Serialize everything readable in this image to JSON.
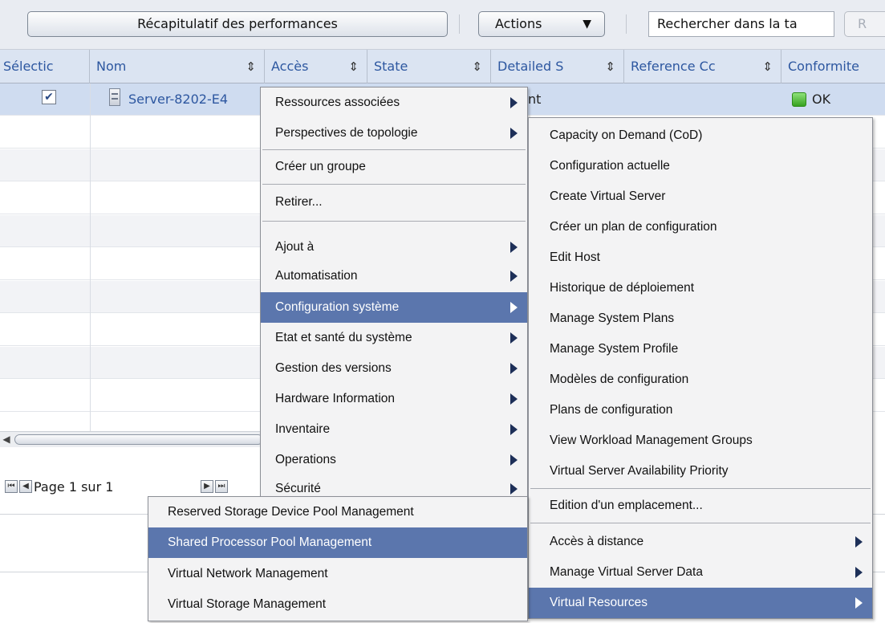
{
  "toolbar": {
    "performance_summary": "Récapitulatif des performances",
    "actions": "Actions",
    "search_value": "Rechercher dans la ta",
    "search_button": "R"
  },
  "table": {
    "columns": [
      "Sélectic",
      "Nom",
      "Accès",
      "State",
      "Detailed S",
      "Reference Cc",
      "Conformite"
    ],
    "row": {
      "checked": true,
      "name": "Server-8202-E4",
      "detailed_state": "nt",
      "compliance": "OK"
    }
  },
  "pagination": {
    "text": "Page 1 sur 1"
  },
  "icons": {
    "sort": "sort-arrows-icon",
    "dropdown": "chevron-down-icon",
    "server": "server-icon",
    "status": "status-ok-icon",
    "submenu": "submenu-arrow-icon"
  },
  "colors": {
    "highlight": "#5b76ad",
    "header_text": "#2d57a0",
    "selected_row": "#cfdcf0",
    "status_ok": "#37a21f"
  },
  "context_menu": {
    "items": [
      {
        "label": "Ressources associées",
        "submenu": true
      },
      {
        "label": "Perspectives de topologie",
        "submenu": true
      },
      {
        "label": "Créer un groupe",
        "submenu": false
      },
      {
        "label": "Retirer...",
        "submenu": false
      },
      {
        "label": "Ajout à",
        "submenu": true
      },
      {
        "label": "Automatisation",
        "submenu": true
      },
      {
        "label": "Configuration système",
        "submenu": true,
        "highlighted": true
      },
      {
        "label": "Etat et santé du système",
        "submenu": true
      },
      {
        "label": "Gestion des versions",
        "submenu": true
      },
      {
        "label": "Hardware Information",
        "submenu": true
      },
      {
        "label": "Inventaire",
        "submenu": true
      },
      {
        "label": "Operations",
        "submenu": true
      },
      {
        "label": "Sécurité",
        "submenu": true
      }
    ]
  },
  "submenu_config": {
    "items": [
      {
        "label": "Capacity on Demand (CoD)"
      },
      {
        "label": "Configuration actuelle"
      },
      {
        "label": "Create Virtual Server"
      },
      {
        "label": "Créer un plan de configuration"
      },
      {
        "label": "Edit Host"
      },
      {
        "label": "Historique de déploiement"
      },
      {
        "label": "Manage System Plans"
      },
      {
        "label": "Manage System Profile"
      },
      {
        "label": "Modèles de configuration"
      },
      {
        "label": "Plans de configuration"
      },
      {
        "label": "View Workload Management Groups"
      },
      {
        "label": "Virtual Server Availability Priority"
      },
      {
        "label": "Edition d'un emplacement..."
      },
      {
        "label": "Accès à distance",
        "submenu": true
      },
      {
        "label": "Manage Virtual Server Data",
        "submenu": true
      },
      {
        "label": "Virtual Resources",
        "submenu": true,
        "highlighted": true
      }
    ]
  },
  "submenu_virtual": {
    "items": [
      {
        "label": "Reserved Storage Device Pool Management"
      },
      {
        "label": "Shared Processor Pool Management",
        "highlighted": true
      },
      {
        "label": "Virtual Network Management"
      },
      {
        "label": "Virtual Storage Management"
      }
    ]
  }
}
